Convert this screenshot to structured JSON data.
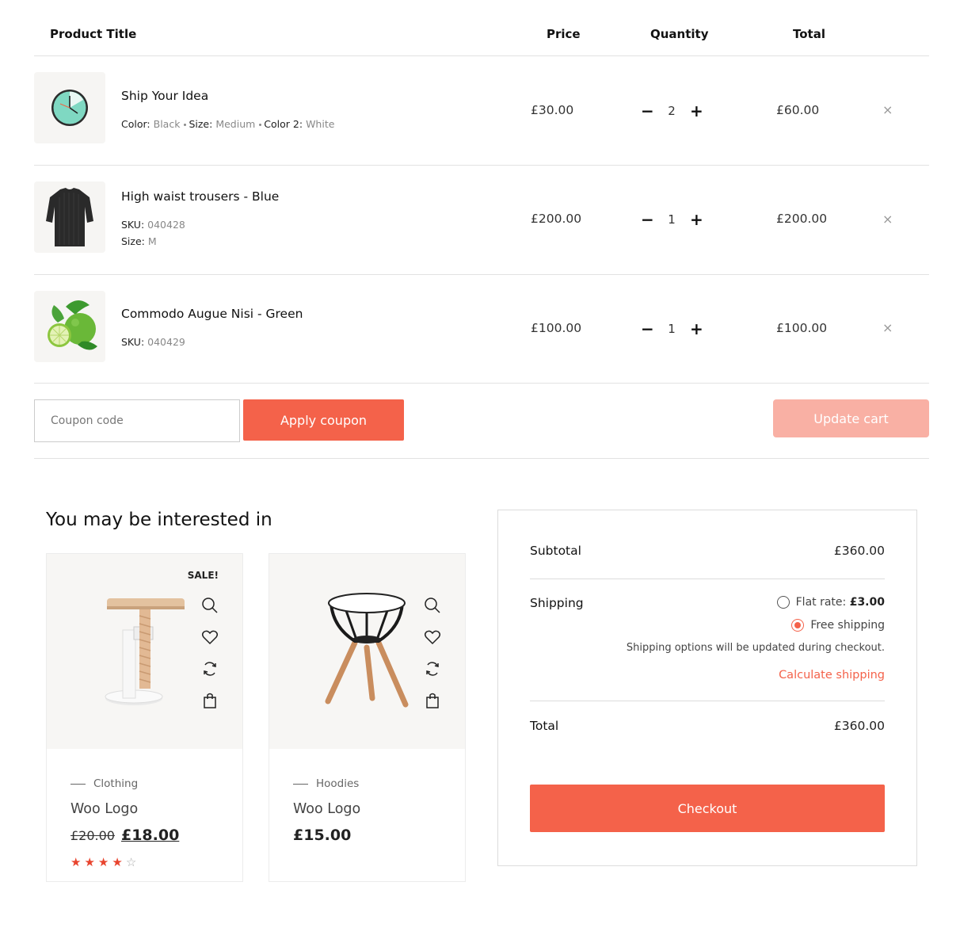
{
  "table": {
    "headers": {
      "product": "Product Title",
      "price": "Price",
      "quantity": "Quantity",
      "total": "Total"
    },
    "rows": [
      {
        "name": "Ship Your Idea",
        "meta": {
          "color_label": "Color:",
          "color": "Black",
          "size_label": "Size:",
          "size": "Medium",
          "color2_label": "Color 2:",
          "color2": "White"
        },
        "price": "£30.00",
        "qty": "2",
        "total": "£60.00",
        "image": "wall-clock"
      },
      {
        "name": "High waist trousers - Blue",
        "meta": {
          "sku_label": "SKU:",
          "sku": "040428",
          "size_label": "Size:",
          "size": "M"
        },
        "price": "£200.00",
        "qty": "1",
        "total": "£200.00",
        "image": "black-tshirt"
      },
      {
        "name": "Commodo Augue Nisi - Green",
        "meta": {
          "sku_label": "SKU:",
          "sku": "040429"
        },
        "price": "£100.00",
        "qty": "1",
        "total": "£100.00",
        "image": "limes"
      }
    ],
    "minus": "−",
    "plus": "+",
    "remove": "×"
  },
  "actions": {
    "coupon_placeholder": "Coupon code",
    "apply_label": "Apply coupon",
    "update_label": "Update cart"
  },
  "crosssell": {
    "title": "You may be interested in",
    "products": [
      {
        "sale": "SALE!",
        "category": "Clothing",
        "name": "Woo Logo",
        "old_price": "£20.00",
        "price": "£18.00",
        "rating": 4,
        "image": "wooden-stool"
      },
      {
        "category": "Hoodies",
        "name": "Woo Logo",
        "price": "£15.00",
        "image": "tripod-stool"
      }
    ]
  },
  "totals": {
    "subtotal_label": "Subtotal",
    "subtotal": "£360.00",
    "shipping_label": "Shipping",
    "flat_rate_label": "Flat rate:",
    "flat_rate": "£3.00",
    "free_shipping": "Free shipping",
    "shipping_note": "Shipping options will be updated during checkout.",
    "calc_shipping": "Calculate shipping",
    "total_label": "Total",
    "total": "£360.00",
    "checkout_label": "Checkout"
  },
  "colors": {
    "accent": "#f4624a",
    "accent_light": "#f9b0a4",
    "star": "#e8442e"
  }
}
